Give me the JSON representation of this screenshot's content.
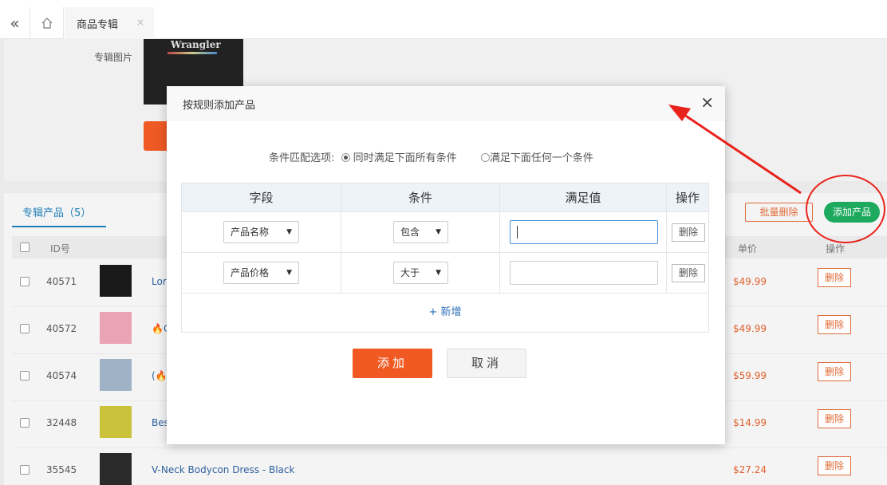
{
  "topbar": {
    "collapse_icon": "«",
    "tab_label": "商品专辑",
    "tab_close": "×"
  },
  "album": {
    "image_label": "专辑图片",
    "image_brand": "Wrangler"
  },
  "products": {
    "tab_title": "专辑产品（5）",
    "batch_delete": "批量删除",
    "add_product": "添加产品",
    "headers": {
      "id": "ID号",
      "price": "单价",
      "action": "操作"
    },
    "rows": [
      {
        "id": "40571",
        "name": "Lor",
        "price": "$49.99",
        "action": "删除",
        "thumb_color": "#1a1a1a"
      },
      {
        "id": "40572",
        "name": "🔥C",
        "price": "$49.99",
        "action": "删除",
        "thumb_color": "#e9a3b4"
      },
      {
        "id": "40574",
        "name": "(🔥",
        "price": "$59.99",
        "action": "删除",
        "thumb_color": "#9eb4c6"
      },
      {
        "id": "32448",
        "name": "Bes",
        "price": "$14.99",
        "action": "删除",
        "thumb_color": "#c9c23a"
      },
      {
        "id": "35545",
        "name": "V-Neck Bodycon Dress - Black",
        "price": "$27.24",
        "action": "删除",
        "thumb_color": "#2a2a2a"
      }
    ]
  },
  "modal": {
    "title": "按规则添加产品",
    "close": "×",
    "match_label": "条件匹配选项:",
    "option_all": "同时满足下面所有条件",
    "option_any": "满足下面任何一个条件",
    "table_headers": {
      "field": "字段",
      "condition": "条件",
      "value": "满足值",
      "action": "操作"
    },
    "rules": [
      {
        "field": "产品名称",
        "condition": "包含",
        "value": "",
        "delete": "删除"
      },
      {
        "field": "产品价格",
        "condition": "大于",
        "value": "",
        "delete": "删除"
      }
    ],
    "add_row": "+ 新增",
    "confirm": "添加",
    "cancel": "取消"
  },
  "colors": {
    "accent": "#f05a22",
    "success": "#1daa5f",
    "link": "#2d6fb6",
    "annotation": "#e8231c"
  }
}
